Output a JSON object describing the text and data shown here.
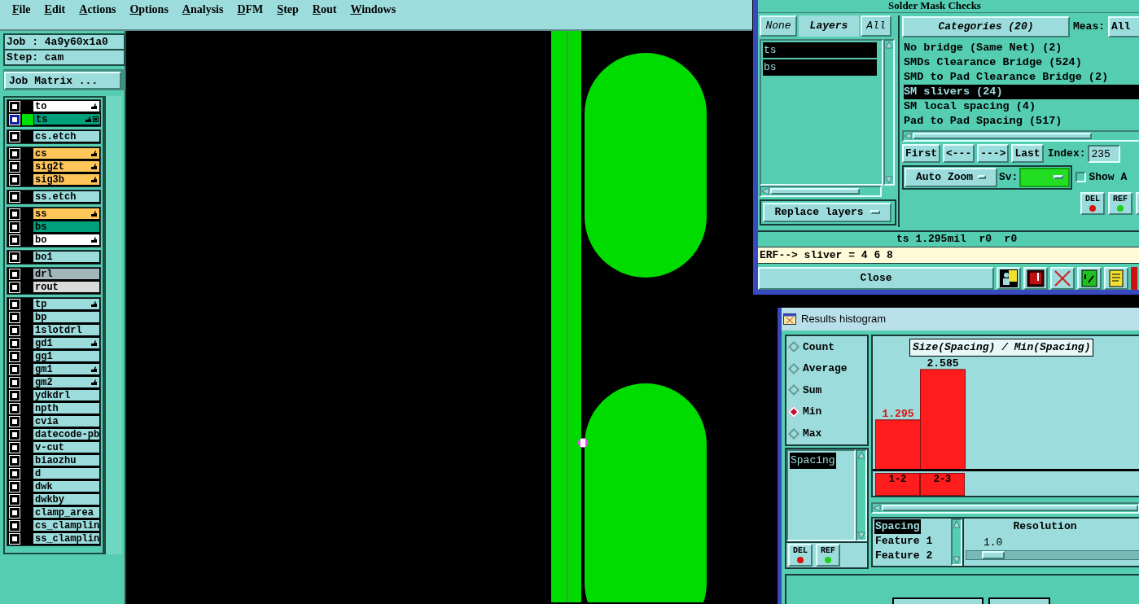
{
  "menu": [
    {
      "label": "File"
    },
    {
      "label": "Edit"
    },
    {
      "label": "Actions"
    },
    {
      "label": "Options"
    },
    {
      "label": "Analysis"
    },
    {
      "label": "DFM"
    },
    {
      "label": "Step"
    },
    {
      "label": "Rout"
    },
    {
      "label": "Windows"
    }
  ],
  "job": {
    "job_line": "Job : 4a9y60x1a0",
    "step_line": "Step: cam",
    "matrix_button": "Job Matrix ..."
  },
  "layer_groups": [
    {
      "layers": [
        {
          "name": "to",
          "color": "#ffffff",
          "selected": false,
          "hand": true,
          "board": false
        },
        {
          "name": "ts",
          "color": "#00a07c",
          "selected": true,
          "hand": true,
          "board": true
        }
      ]
    },
    {
      "layers": [
        {
          "name": "cs.etch",
          "color": "#9ddcdc",
          "selected": false,
          "hand": false,
          "board": false
        }
      ]
    },
    {
      "layers": [
        {
          "name": "cs",
          "color": "#ffc65a",
          "selected": false,
          "hand": true,
          "board": false
        },
        {
          "name": "sig2t",
          "color": "#ffc65a",
          "selected": false,
          "hand": true,
          "board": false
        },
        {
          "name": "sig3b",
          "color": "#ffc65a",
          "selected": false,
          "hand": true,
          "board": false
        }
      ]
    },
    {
      "layers": [
        {
          "name": "ss.etch",
          "color": "#9ddcdc",
          "selected": false,
          "hand": false,
          "board": false
        }
      ]
    },
    {
      "layers": [
        {
          "name": "ss",
          "color": "#ffc65a",
          "selected": false,
          "hand": true,
          "board": false
        },
        {
          "name": "bs",
          "color": "#00a07c",
          "selected": false,
          "hand": false,
          "board": false
        },
        {
          "name": "bo",
          "color": "#ffffff",
          "selected": false,
          "hand": true,
          "board": false
        }
      ]
    },
    {
      "layers": [
        {
          "name": "bo1",
          "color": "#9ddcdc",
          "selected": false,
          "hand": false,
          "board": false
        }
      ]
    },
    {
      "layers": [
        {
          "name": "drl",
          "color": "#a3b6ba",
          "selected": false,
          "hand": false,
          "board": false
        },
        {
          "name": "rout",
          "color": "#dadada",
          "selected": false,
          "hand": false,
          "board": false
        }
      ]
    },
    {
      "layers": [
        {
          "name": "tp",
          "color": "#9ddcdc",
          "selected": false,
          "hand": true,
          "board": false
        },
        {
          "name": "bp",
          "color": "#9ddcdc",
          "selected": false,
          "hand": false,
          "board": false
        },
        {
          "name": "1slotdrl",
          "color": "#9ddcdc",
          "selected": false,
          "hand": false,
          "board": false
        },
        {
          "name": "gd1",
          "color": "#9ddcdc",
          "selected": false,
          "hand": true,
          "board": false
        },
        {
          "name": "gg1",
          "color": "#9ddcdc",
          "selected": false,
          "hand": false,
          "board": false
        },
        {
          "name": "gm1",
          "color": "#9ddcdc",
          "selected": false,
          "hand": true,
          "board": false
        },
        {
          "name": "gm2",
          "color": "#9ddcdc",
          "selected": false,
          "hand": true,
          "board": false
        },
        {
          "name": "ydkdrl",
          "color": "#9ddcdc",
          "selected": false,
          "hand": false,
          "board": false
        },
        {
          "name": "npth",
          "color": "#9ddcdc",
          "selected": false,
          "hand": false,
          "board": false
        },
        {
          "name": "cvia",
          "color": "#9ddcdc",
          "selected": false,
          "hand": false,
          "board": false
        },
        {
          "name": "datecode-pb",
          "color": "#9ddcdc",
          "selected": false,
          "hand": false,
          "board": false
        },
        {
          "name": "v-cut",
          "color": "#9ddcdc",
          "selected": false,
          "hand": false,
          "board": false
        },
        {
          "name": "biaozhu",
          "color": "#9ddcdc",
          "selected": false,
          "hand": false,
          "board": false
        },
        {
          "name": "d",
          "color": "#9ddcdc",
          "selected": false,
          "hand": false,
          "board": false
        },
        {
          "name": "dwk",
          "color": "#9ddcdc",
          "selected": false,
          "hand": false,
          "board": false
        },
        {
          "name": "dwkby",
          "color": "#9ddcdc",
          "selected": false,
          "hand": false,
          "board": false
        },
        {
          "name": "clamp_area",
          "color": "#9ddcdc",
          "selected": false,
          "hand": false,
          "board": false
        },
        {
          "name": "cs_clamplin",
          "color": "#9ddcdc",
          "selected": false,
          "hand": false,
          "board": false
        },
        {
          "name": "ss_clamplin",
          "color": "#9ddcdc",
          "selected": false,
          "hand": false,
          "board": false
        }
      ]
    }
  ],
  "checks_window": {
    "title": "Solder Mask Checks",
    "layer_buttons": {
      "none": "None",
      "label": "Layers",
      "all": "All"
    },
    "layers": [
      {
        "name": "ts",
        "selected": true
      },
      {
        "name": "bs",
        "selected": true
      }
    ],
    "replace_button": "Replace layers",
    "categories_button": "Categories (20)",
    "meas_label": "Meas:",
    "meas_button": "All",
    "categories": [
      {
        "label": "No bridge (Same Net) (2)",
        "selected": false
      },
      {
        "label": "SMDs Clearance Bridge (524)",
        "selected": false
      },
      {
        "label": "SMD to Pad Clearance Bridge (2)",
        "selected": false
      },
      {
        "label": "SM slivers (24)",
        "selected": true
      },
      {
        "label": "SM local spacing (4)",
        "selected": false
      },
      {
        "label": "Pad to Pad Spacing (517)",
        "selected": false
      }
    ],
    "nav_buttons": [
      "First",
      "<---",
      "--->",
      "Last"
    ],
    "index_label": "Index:",
    "index_value": "235",
    "zoom_button": "Auto Zoom",
    "sv_label": "Sv:",
    "show_checkbox": {
      "label": "Show A",
      "checked": false
    },
    "del_button": "DEL",
    "ref_button": "REF",
    "status": "ts 1.295mil  r0  r0",
    "erf_line": "ERF--> sliver = 4 6 8",
    "close_button": "Close"
  },
  "histogram_window": {
    "title": "Results histogram",
    "modes": [
      {
        "label": "Count",
        "selected": false
      },
      {
        "label": "Average",
        "selected": false
      },
      {
        "label": "Sum",
        "selected": false
      },
      {
        "label": "Min",
        "selected": true
      },
      {
        "label": "Max",
        "selected": false
      }
    ],
    "measures": [
      {
        "label": "Spacing",
        "selected": true
      }
    ],
    "del_button": "DEL",
    "ref_button": "REF",
    "chart_data": {
      "type": "bar",
      "title": "Size(Spacing) / Min(Spacing)",
      "categories": [
        "1-2",
        "2-3"
      ],
      "values": [
        1.295,
        2.585
      ],
      "data_labels": true
    },
    "fields": [
      {
        "label": "Spacing",
        "selected": true
      },
      {
        "label": "Feature 1",
        "selected": false
      },
      {
        "label": "Feature 2",
        "selected": false
      }
    ],
    "resolution": {
      "label": "Resolution",
      "value": "1.0",
      "level": 0.09
    }
  }
}
